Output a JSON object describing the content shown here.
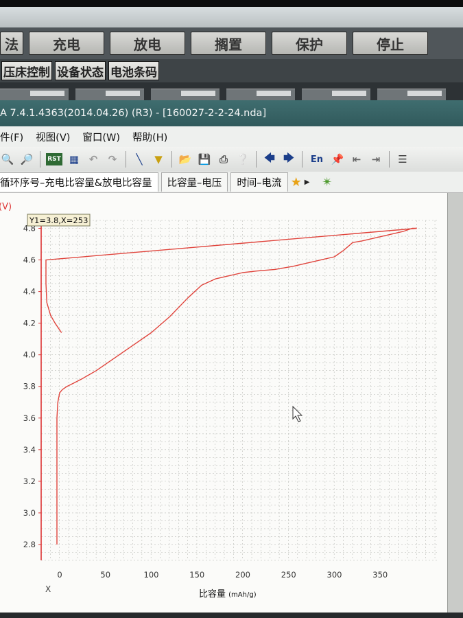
{
  "ops": {
    "partial": "法",
    "buttons": [
      "充电",
      "放电",
      "搁置",
      "保护",
      "停止"
    ]
  },
  "subtabs": [
    "压床控制",
    "设备状态",
    "电池条码"
  ],
  "window": {
    "title": "A 7.4.1.4363(2014.04.26) (R3) - [160027-2-2-24.nda]"
  },
  "menu": [
    "件(F)",
    "视图(V)",
    "窗口(W)",
    "帮助(H)"
  ],
  "toolbar": {
    "icons": [
      "zoom-in-icon",
      "zoom-out-icon",
      "rst-icon",
      "copy-icon",
      "undo-icon",
      "redo-icon",
      "line-icon",
      "filter-icon",
      "open-icon",
      "save-icon",
      "print-icon",
      "help-icon",
      "back-icon",
      "forward-icon",
      "en-icon",
      "pin-icon",
      "align-left-icon",
      "align-right-icon",
      "list-icon"
    ],
    "rst_label": "RST",
    "en_label": "En"
  },
  "tabs": [
    {
      "label": "循环序号–充电比容量&放电比容量",
      "active": true
    },
    {
      "label": "比容量–电压",
      "active": false
    },
    {
      "label": "时间–电流",
      "active": false
    }
  ],
  "chart_data": {
    "type": "line",
    "ylabel": "(V)",
    "xlabel": "比容量",
    "xunit": "(mAh/g)",
    "xlim": [
      0,
      390
    ],
    "ylim": [
      2.7,
      4.85
    ],
    "y_ticks": [
      2.8,
      3.0,
      3.2,
      3.4,
      3.6,
      3.8,
      4.0,
      4.2,
      4.4,
      4.6,
      4.8
    ],
    "x_ticks": [
      0,
      50,
      100,
      150,
      200,
      250,
      300,
      350
    ],
    "readout": "Y1=3.8,X=253",
    "corner_label": "X",
    "series": [
      {
        "color": "#e0443c",
        "x": [
          -3,
          -3,
          -2,
          0,
          3,
          8,
          15,
          25,
          40,
          60,
          80,
          100,
          120,
          140,
          155,
          170,
          185,
          200,
          215,
          235,
          255,
          270,
          285,
          300,
          310,
          320,
          330,
          345,
          360,
          375,
          385,
          390
        ],
        "y": [
          2.8,
          3.6,
          3.7,
          3.76,
          3.78,
          3.8,
          3.82,
          3.85,
          3.9,
          3.98,
          4.06,
          4.14,
          4.24,
          4.36,
          4.44,
          4.48,
          4.5,
          4.52,
          4.53,
          4.54,
          4.56,
          4.58,
          4.6,
          4.62,
          4.66,
          4.71,
          4.72,
          4.74,
          4.76,
          4.78,
          4.8,
          4.8
        ]
      },
      {
        "color": "#e0443c",
        "x": [
          2,
          -5,
          -10,
          -14,
          -15,
          -15,
          -15,
          390
        ],
        "y": [
          4.14,
          4.2,
          4.25,
          4.33,
          4.45,
          4.55,
          4.6,
          4.8
        ]
      }
    ]
  }
}
